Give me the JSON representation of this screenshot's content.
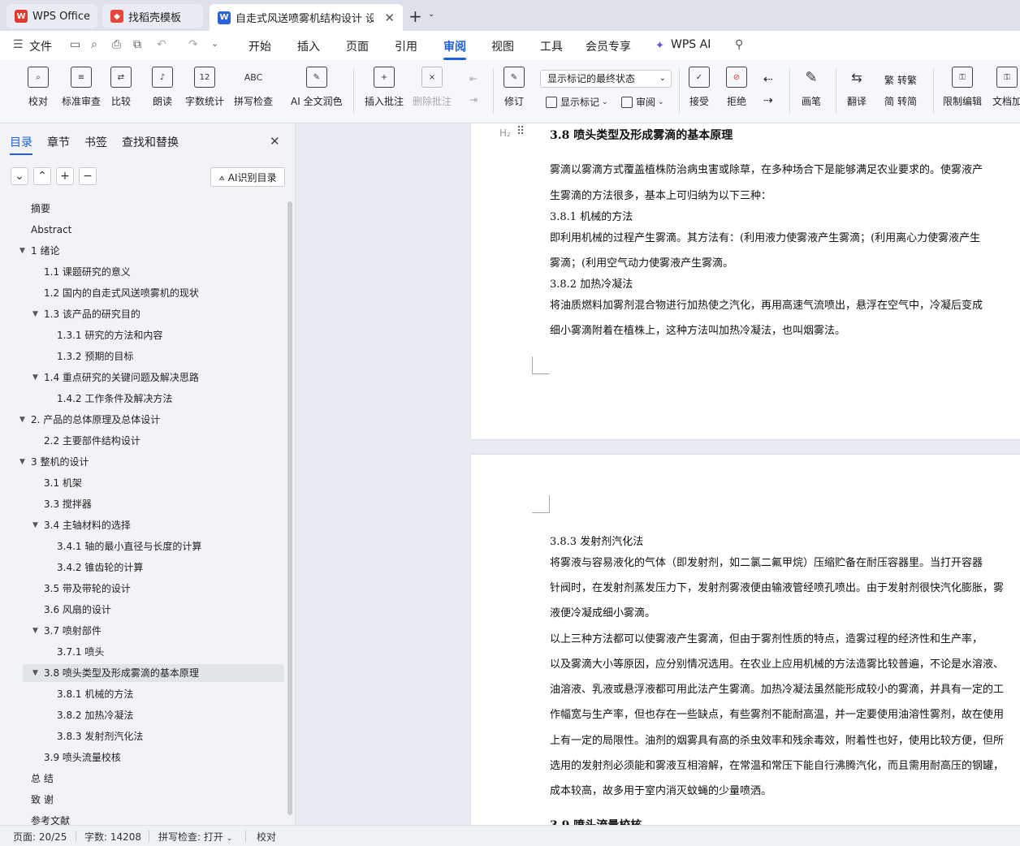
{
  "tabs": [
    {
      "label": "WPS Office"
    },
    {
      "label": "找稻壳模板"
    },
    {
      "label": "自走式风送喷雾机结构设计 设"
    }
  ],
  "menu": {
    "file": "文件",
    "items": [
      "开始",
      "插入",
      "页面",
      "引用",
      "审阅",
      "视图",
      "工具",
      "会员专享",
      "WPS AI"
    ],
    "selected": "审阅"
  },
  "ribbon": {
    "buttons": [
      "校对",
      "标准审查",
      "比较",
      "朗读",
      "字数统计",
      "拼写检查",
      "AI 全文润色",
      "插入批注",
      "删除批注",
      "修订",
      "接受",
      "拒绝",
      "画笔",
      "翻译",
      "限制编辑",
      "文档加"
    ],
    "display_select": "显示标记的最终状态",
    "show_marks": "显示标记",
    "review": "审阅",
    "to_traditional": "转繁",
    "to_simplified": "转简"
  },
  "sidebar": {
    "tabs": [
      "目录",
      "章节",
      "书签",
      "查找和替换"
    ],
    "ai_button": "AI识别目录",
    "toc": [
      {
        "text": "摘要",
        "level": 0,
        "arrow": false
      },
      {
        "text": "Abstract",
        "level": 0,
        "arrow": false
      },
      {
        "text": "1  绪论",
        "level": 0,
        "arrow": true
      },
      {
        "text": "1.1 课题研究的意义",
        "level": 1,
        "arrow": false
      },
      {
        "text": "1.2 国内的自走式风送喷雾机的现状",
        "level": 1,
        "arrow": false
      },
      {
        "text": "1.3  该产品的研究目的",
        "level": 1,
        "arrow": true
      },
      {
        "text": "1.3.1  研究的方法和内容",
        "level": 2,
        "arrow": false
      },
      {
        "text": "1.3.2 预期的目标",
        "level": 2,
        "arrow": false
      },
      {
        "text": "1.4 重点研究的关键问题及解决思路",
        "level": 1,
        "arrow": true
      },
      {
        "text": "1.4.2 工作条件及解决方法",
        "level": 2,
        "arrow": false
      },
      {
        "text": "2.  产品的总体原理及总体设计",
        "level": 0,
        "arrow": true
      },
      {
        "text": "2.2  主要部件结构设计",
        "level": 1,
        "arrow": false
      },
      {
        "text": "3  整机的设计",
        "level": 0,
        "arrow": true
      },
      {
        "text": "3.1  机架",
        "level": 1,
        "arrow": false
      },
      {
        "text": "3.3  搅拌器",
        "level": 1,
        "arrow": false
      },
      {
        "text": "3.4  主轴材料的选择",
        "level": 1,
        "arrow": true
      },
      {
        "text": "3.4.1  轴的最小直径与长度的计算",
        "level": 2,
        "arrow": false
      },
      {
        "text": "3.4.2  锥齿轮的计算",
        "level": 2,
        "arrow": false
      },
      {
        "text": "3.5  带及带轮的设计",
        "level": 1,
        "arrow": false
      },
      {
        "text": "3.6  风扇的设计",
        "level": 1,
        "arrow": false
      },
      {
        "text": "3.7 喷射部件",
        "level": 1,
        "arrow": true
      },
      {
        "text": "3.7.1  喷头",
        "level": 2,
        "arrow": false
      },
      {
        "text": "3.8 喷头类型及形成雾滴的基本原理",
        "level": 1,
        "arrow": true,
        "highlight": true
      },
      {
        "text": "3.8.1  机械的方法",
        "level": 2,
        "arrow": false
      },
      {
        "text": "3.8.2  加热冷凝法",
        "level": 2,
        "arrow": false
      },
      {
        "text": "3.8.3  发射剂汽化法",
        "level": 2,
        "arrow": false
      },
      {
        "text": "3.9  喷头流量校核",
        "level": 1,
        "arrow": false
      },
      {
        "text": "总    结",
        "level": 0,
        "arrow": false
      },
      {
        "text": "致    谢",
        "level": 0,
        "arrow": false
      },
      {
        "text": "参考文献",
        "level": 0,
        "arrow": false
      }
    ]
  },
  "document": {
    "page1": [
      {
        "text": "3.8 喷头类型及形成雾滴的基本原理",
        "style": "h"
      },
      {
        "text": "        雾滴以雾滴方式覆盖植株防治病虫害或除草，在多种场合下是能够满足农业要求的。使雾液产",
        "style": "p"
      },
      {
        "text": "生雾滴的方法很多，基本上可归纳为以下三种：",
        "style": "p"
      },
      {
        "text": "3.8.1  机械的方法",
        "style": "p"
      },
      {
        "text": "        即利用机械的过程产生雾滴。其方法有：(利用液力使雾液产生雾滴；(利用离心力使雾液产生",
        "style": "p"
      },
      {
        "text": "雾滴；(利用空气动力使雾液产生雾滴。",
        "style": "p"
      },
      {
        "text": "3.8.2  加热冷凝法",
        "style": "p"
      },
      {
        "text": "        将油质燃料加雾剂混合物进行加热使之汽化，再用高速气流喷出，悬浮在空气中，冷凝后变成",
        "style": "p"
      },
      {
        "text": "细小雾滴附着在植株上，这种方法叫加热冷凝法，也叫烟雾法。",
        "style": "p"
      }
    ],
    "page2": [
      {
        "text": "3.8.3  发射剂汽化法",
        "style": "p"
      },
      {
        "text": "        将雾液与容易液化的气体（即发射剂，如二氯二氟甲烷）压缩贮备在耐压容器里。当打开容器",
        "style": "p"
      },
      {
        "text": "针阀时，在发射剂蒸发压力下，发射剂雾液便由输液管经喷孔喷出。由于发射剂很快汽化膨胀，雾",
        "style": "p"
      },
      {
        "text": "液便冷凝成细小雾滴。",
        "style": "p"
      },
      {
        "text": "        以上三种方法都可以使雾液产生雾滴，但由于雾剂性质的特点，造雾过程的经济性和生产率，",
        "style": "p"
      },
      {
        "text": "以及雾滴大小等原因，应分别情况选用。在农业上应用机械的方法造雾比较普遍，不论是水溶液、",
        "style": "p"
      },
      {
        "text": "油溶液、乳液或悬浮液都可用此法产生雾滴。加热冷凝法虽然能形成较小的雾滴，并具有一定的工",
        "style": "p"
      },
      {
        "text": "作幅宽与生产率，但也存在一些缺点，有些雾剂不能耐高温，并一定要使用油溶性雾剂，故在使用",
        "style": "p"
      },
      {
        "text": "上有一定的局限性。油剂的烟雾具有高的杀虫效率和残余毒效，附着性也好，使用比较方便，但所",
        "style": "p"
      },
      {
        "text": "选用的发射剂必须能和雾液互相溶解，在常温和常压下能自行沸腾汽化，而且需用耐高压的钢罐，",
        "style": "p"
      },
      {
        "text": "成本较高，故多用于室内消灭蚊蝇的少量喷洒。",
        "style": "p"
      },
      {
        "text": "3.9  喷头流量校核",
        "style": "h"
      }
    ]
  },
  "status": {
    "page": "页面: 20/25",
    "words": "字数: 14208",
    "spell": "拼写检查: 打开",
    "proof": "校对"
  }
}
